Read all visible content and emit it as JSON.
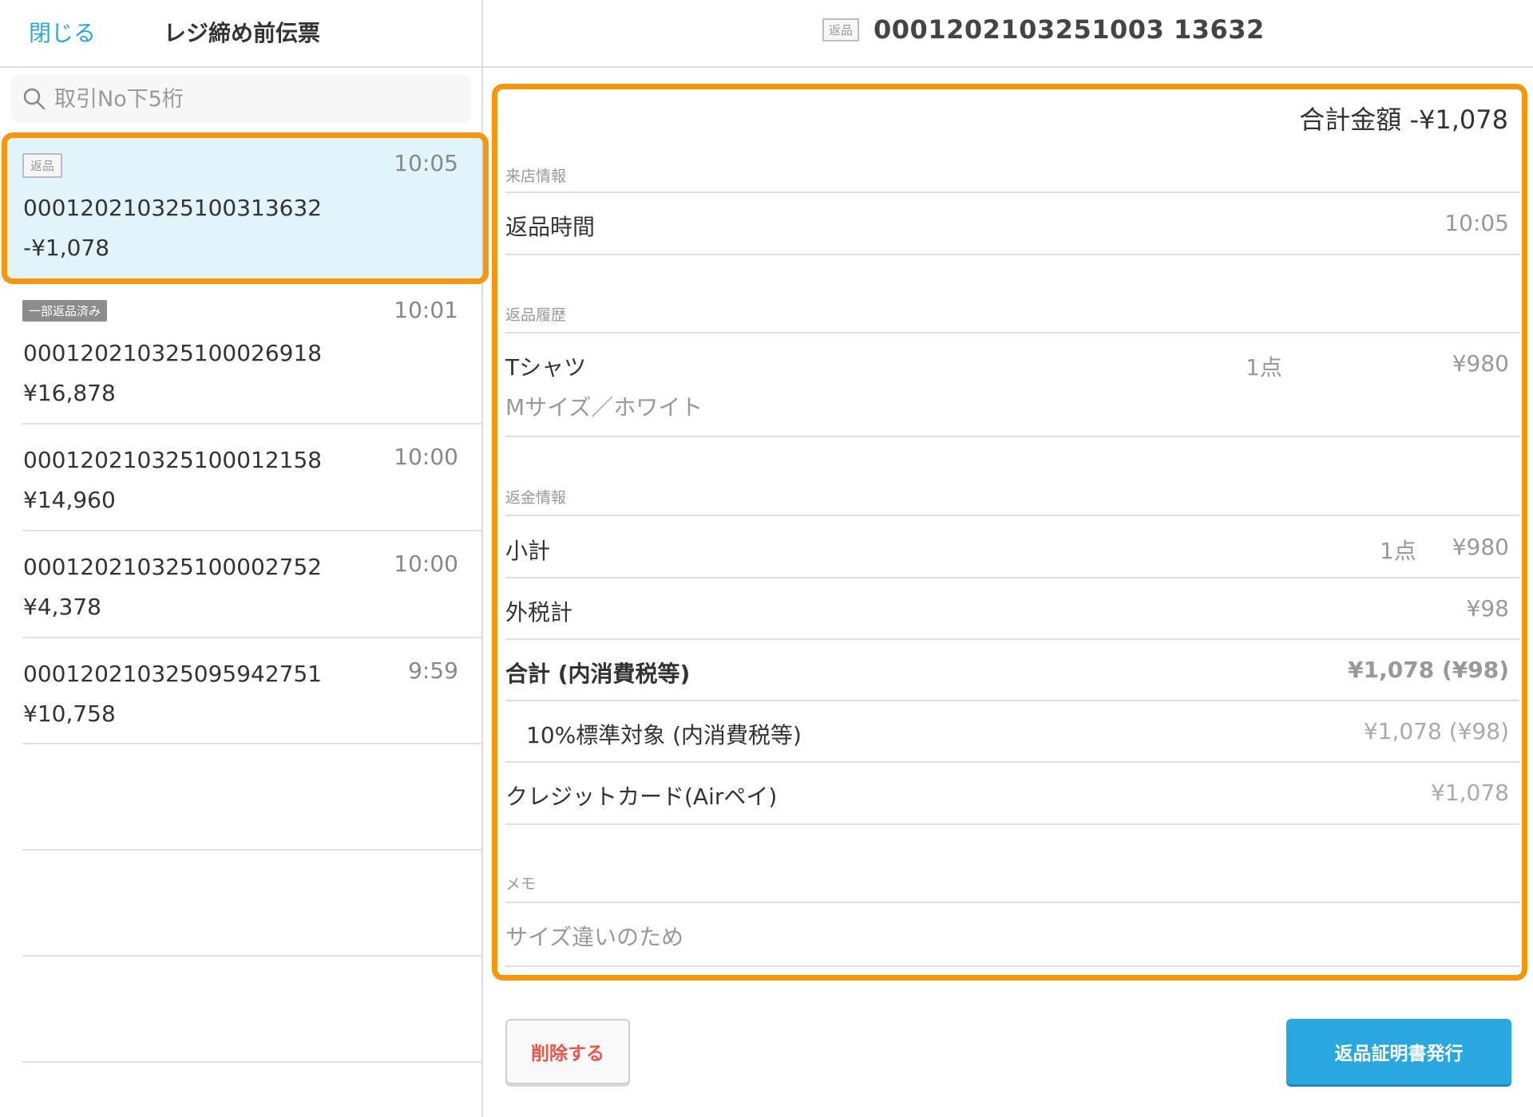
{
  "header": {
    "close_label": "閉じる",
    "left_title": "レジ締め前伝票",
    "detail_badge": "返品",
    "detail_number": "0001202103251003 13632"
  },
  "search": {
    "placeholder": "取引No下5桁"
  },
  "transactions": [
    {
      "tag": "返品",
      "time": "10:05",
      "number": "000120210325100313632",
      "amount": "-¥1,078"
    },
    {
      "tag": "一部返品済み",
      "time": "10:01",
      "number": "000120210325100026918",
      "amount": "¥16,878"
    },
    {
      "tag": "",
      "time": "10:00",
      "number": "000120210325100012158",
      "amount": "¥14,960"
    },
    {
      "tag": "",
      "time": "10:00",
      "number": "000120210325100002752",
      "amount": "¥4,378"
    },
    {
      "tag": "",
      "time": "9:59",
      "number": "000120210325095942751",
      "amount": "¥10,758"
    }
  ],
  "detail": {
    "total_label": "合計金額 -¥1,078",
    "visit_section": "来店情報",
    "return_time_label": "返品時間",
    "return_time_value": "10:05",
    "history_section": "返品履歴",
    "item_name": "Tシャツ",
    "item_variant": "Mサイズ／ホワイト",
    "item_qty": "1点",
    "item_price": "¥980",
    "refund_section": "返金情報",
    "subtotal_label": "小計",
    "subtotal_qty": "1点",
    "subtotal_value": "¥980",
    "tax_label": "外税計",
    "tax_value": "¥98",
    "sum_label": "合計 (内消費税等)",
    "sum_value": "¥1,078 (¥98)",
    "rate_label": "10%標準対象 (内消費税等)",
    "rate_value": "¥1,078 (¥98)",
    "payment_label": "クレジットカード(Airペイ)",
    "payment_value": "¥1,078",
    "memo_section": "メモ",
    "memo_text": "サイズ違いのため"
  },
  "buttons": {
    "delete": "削除する",
    "issue": "返品証明書発行"
  },
  "colors": {
    "accent": "#29a8d9",
    "highlight": "#f7960b",
    "selected_bg": "#e1f3fb",
    "danger": "#e9574a"
  }
}
